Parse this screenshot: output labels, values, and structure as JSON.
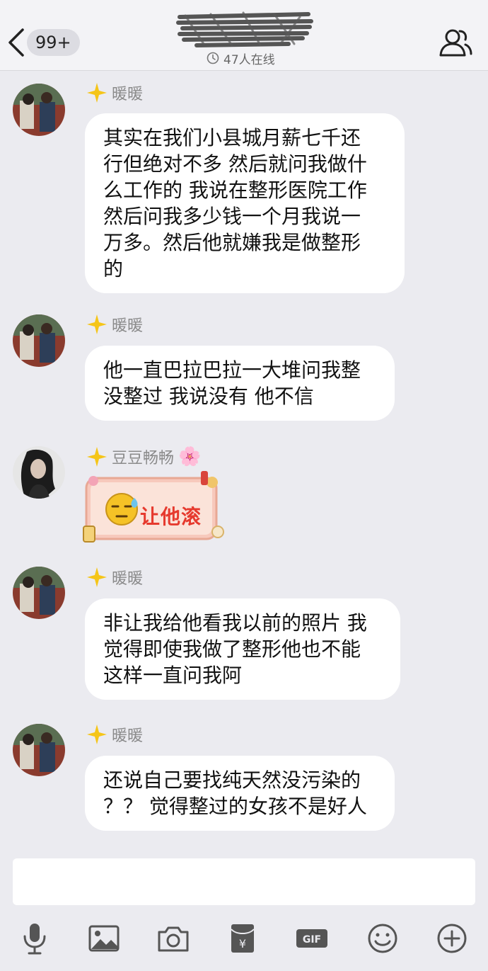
{
  "header": {
    "unread_badge": "99+",
    "online_status": "47人在线"
  },
  "messages": [
    {
      "sender": "暖暖",
      "type": "text",
      "text": "其实在我们小县城月薪七千还\n行但绝对不多 然后就问我做什\n么工作的 我说在整形医院工作\n然后问我多少钱一个月我说一\n万多。然后他就嫌我是做整形\n的"
    },
    {
      "sender": "暖暖",
      "type": "text",
      "text": "他一直巴拉巴拉一大堆问我整\n没整过 我说没有 他不信"
    },
    {
      "sender": "豆豆畅畅",
      "sender_suffix": "🌸",
      "type": "sticker",
      "text": "让他滚"
    },
    {
      "sender": "暖暖",
      "type": "text",
      "text": "非让我给他看我以前的照片 我\n觉得即使我做了整形他也不能\n这样一直问我阿"
    },
    {
      "sender": "暖暖",
      "type": "text",
      "text": "还说自己要找纯天然没污染的\n？？ 觉得整过的女孩不是好人"
    }
  ],
  "input": {
    "value": ""
  },
  "toolbar": {
    "icons": [
      "microphone-icon",
      "image-icon",
      "camera-icon",
      "red-packet-icon",
      "gif-icon",
      "emoji-icon",
      "plus-icon"
    ]
  },
  "colors": {
    "background": "#ebebf0",
    "bubble": "#ffffff",
    "sender_name": "#8a8a8a",
    "badge_star": "#f5c518",
    "sticker_text": "#e63a2e"
  }
}
